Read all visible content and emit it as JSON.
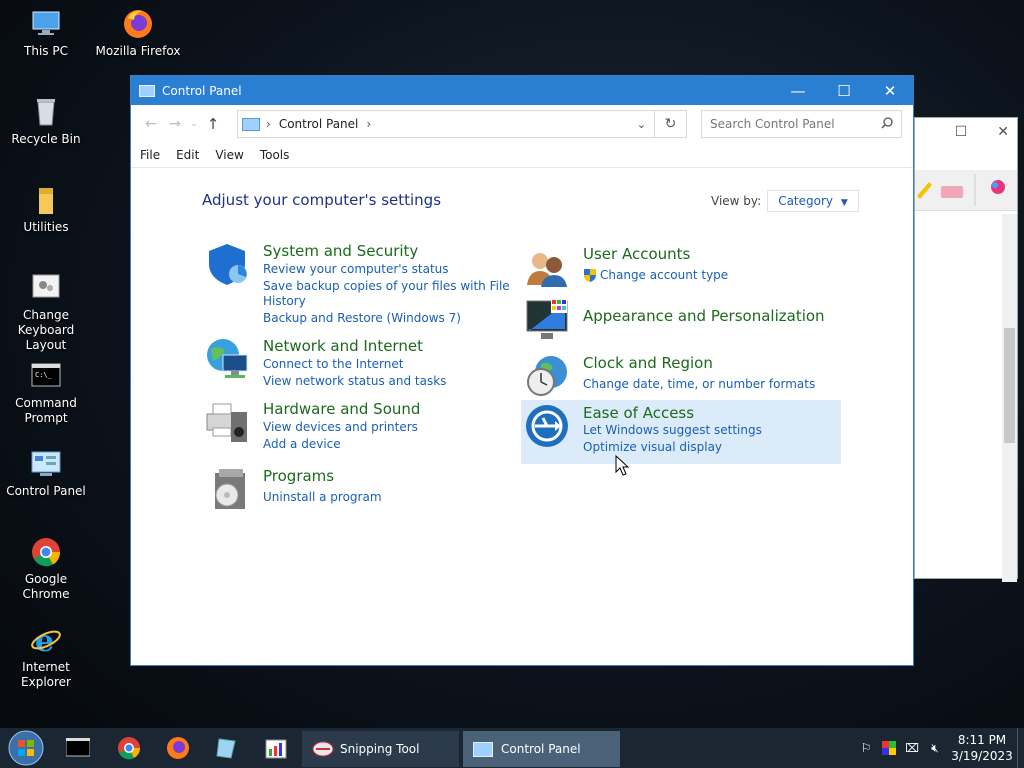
{
  "desktop": {
    "icons": [
      {
        "label": "This PC"
      },
      {
        "label": "Mozilla Firefox"
      },
      {
        "label": "Recycle Bin"
      },
      {
        "label": "Utilities"
      },
      {
        "label": "Change Keyboard Layout"
      },
      {
        "label": "Command Prompt"
      },
      {
        "label": "Control Panel"
      },
      {
        "label": "Google Chrome"
      },
      {
        "label": "Internet Explorer"
      }
    ]
  },
  "window": {
    "title": "Control Panel",
    "controls": {
      "minimize": "—",
      "maximize": "☐",
      "close": "✕"
    },
    "address": {
      "crumb": "Control Panel"
    },
    "search": {
      "placeholder": "Search Control Panel"
    },
    "menu": [
      "File",
      "Edit",
      "View",
      "Tools"
    ],
    "heading": "Adjust your computer's settings",
    "view_by": {
      "label": "View by:",
      "value": "Category"
    },
    "categories_left": [
      {
        "title": "System and Security",
        "links": [
          "Review your computer's status",
          "Save backup copies of your files with File",
          "History",
          "Backup and Restore (Windows 7)"
        ]
      },
      {
        "title": "Network and Internet",
        "links": [
          "Connect to the Internet",
          "View network status and tasks"
        ]
      },
      {
        "title": "Hardware and Sound",
        "links": [
          "View devices and printers",
          "Add a device"
        ]
      },
      {
        "title": "Programs",
        "links": [
          "Uninstall a program"
        ]
      }
    ],
    "categories_right": [
      {
        "title": "User Accounts",
        "links": [
          "Change account type"
        ]
      },
      {
        "title": "Appearance and Personalization",
        "links": []
      },
      {
        "title": "Clock and Region",
        "links": [
          "Change date, time, or number formats"
        ]
      },
      {
        "title": "Ease of Access",
        "links": [
          "Let Windows suggest settings",
          "Optimize visual display"
        ]
      }
    ]
  },
  "taskbar": {
    "apps": [
      {
        "label": "Snipping Tool"
      },
      {
        "label": "Control Panel"
      }
    ],
    "clock": {
      "time": "8:11 PM",
      "date": "3/19/2023"
    }
  },
  "colors": {
    "titlebar": "#2b7fd3",
    "category_title": "#1c6a1c",
    "link": "#1a5fb4",
    "heading": "#1e3287",
    "highlight": "#dcebf9"
  }
}
